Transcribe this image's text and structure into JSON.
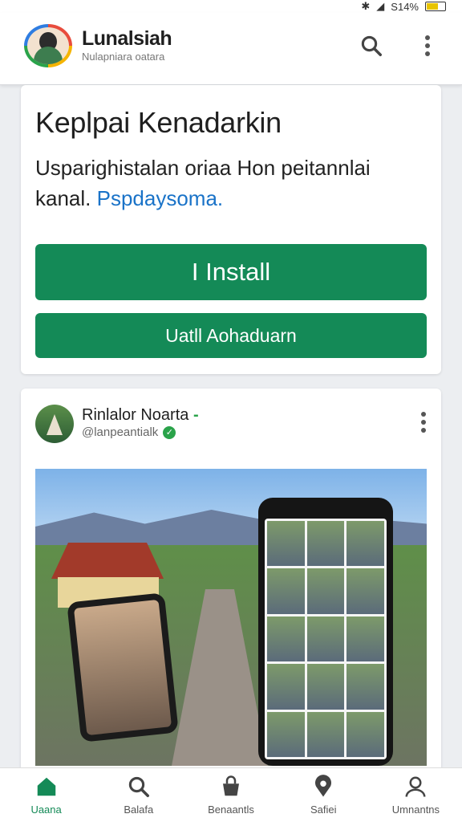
{
  "status": {
    "battery": "S14%"
  },
  "appbar": {
    "title": "Lunalsiah",
    "subtitle": "Nulapniara oatara",
    "search_icon": "search-icon",
    "menu_icon": "kebab-menu-icon"
  },
  "hero": {
    "title": "Keplpai Kenadarkin",
    "desc": "Usparighistalan oriaa Hon peitannlai kanal.",
    "link": "Pspdaysoma.",
    "install_button": "I Install",
    "secondary_button": "Uatll Aohaduarn"
  },
  "post": {
    "name": "Rinlalor Noarta",
    "dash": "-",
    "handle": "@lanpeantialk",
    "verified": "✓"
  },
  "nav": {
    "items": [
      {
        "label": "Uaana",
        "icon": "home-icon"
      },
      {
        "label": "Balafa",
        "icon": "search-icon"
      },
      {
        "label": "Benaantls",
        "icon": "bag-icon"
      },
      {
        "label": "Safiei",
        "icon": "location-icon"
      },
      {
        "label": "Umnantns",
        "icon": "user-icon"
      }
    ]
  }
}
